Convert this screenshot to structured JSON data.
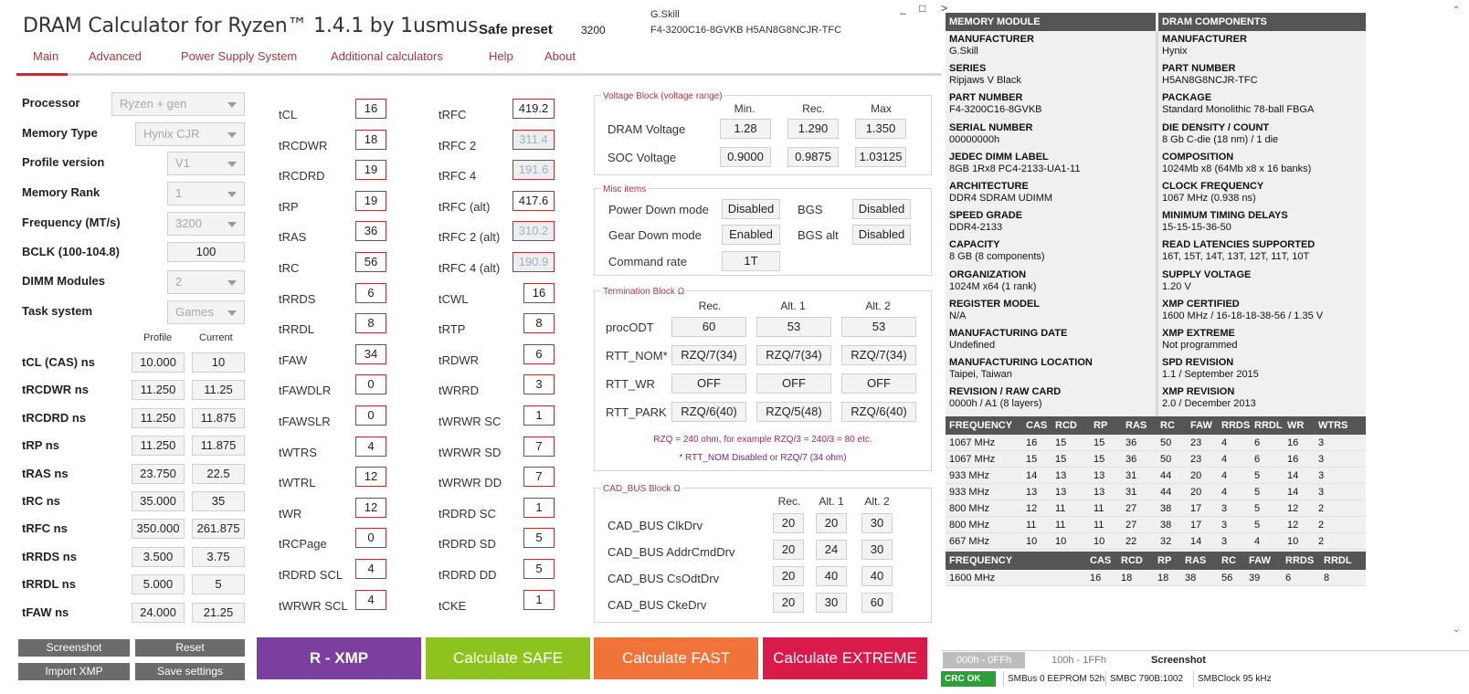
{
  "app": {
    "title": "DRAM Calculator for Ryzen™ 1.4.1 by 1usmus",
    "preset_label": "Safe preset",
    "preset_value": "3200",
    "module_brand": "G.Skill",
    "module_part": "F4-3200C16-8GVKB  H5AN8G8NCJR-TFC",
    "window_min": "_",
    "window_max": "□",
    "window_close": ">"
  },
  "tabs": [
    "Main",
    "Advanced",
    "Power Supply System",
    "Additional calculators",
    "Help",
    "About"
  ],
  "settings": [
    {
      "label": "Processor",
      "value": "Ryzen + gen"
    },
    {
      "label": "Memory Type",
      "value": "Hynix CJR"
    },
    {
      "label": "Profile version",
      "value": "V1"
    },
    {
      "label": "Memory Rank",
      "value": "1"
    },
    {
      "label": "Frequency (MT/s)",
      "value": "3200"
    },
    {
      "label": "BCLK (100-104.8)",
      "value": "100"
    },
    {
      "label": "DIMM Modules",
      "value": "2"
    },
    {
      "label": "Task system",
      "value": "Games"
    }
  ],
  "ns": {
    "col_profile": "Profile",
    "col_current": "Current",
    "rows": [
      {
        "label": "tCL (CAS) ns",
        "profile": "10.000",
        "current": "10"
      },
      {
        "label": "tRCDWR ns",
        "profile": "11.250",
        "current": "11.25"
      },
      {
        "label": "tRCDRD ns",
        "profile": "11.250",
        "current": "11.875"
      },
      {
        "label": "tRP ns",
        "profile": "11.250",
        "current": "11.875"
      },
      {
        "label": "tRAS ns",
        "profile": "23.750",
        "current": "22.5"
      },
      {
        "label": "tRC ns",
        "profile": "35.000",
        "current": "35"
      },
      {
        "label": "tRFC ns",
        "profile": "350.000",
        "current": "261.875"
      },
      {
        "label": "tRRDS ns",
        "profile": "3.500",
        "current": "3.75"
      },
      {
        "label": "tRRDL ns",
        "profile": "5.000",
        "current": "5"
      },
      {
        "label": "tFAW ns",
        "profile": "24.000",
        "current": "21.25"
      }
    ]
  },
  "timings_a": [
    {
      "label": "tCL",
      "value": "16"
    },
    {
      "label": "tRCDWR",
      "value": "18"
    },
    {
      "label": "tRCDRD",
      "value": "19"
    },
    {
      "label": "tRP",
      "value": "19"
    },
    {
      "label": "tRAS",
      "value": "36"
    },
    {
      "label": "tRC",
      "value": "56"
    },
    {
      "label": "tRRDS",
      "value": "6"
    },
    {
      "label": "tRRDL",
      "value": "8"
    },
    {
      "label": "tFAW",
      "value": "34"
    },
    {
      "label": "tFAWDLR",
      "value": "0"
    },
    {
      "label": "tFAWSLR",
      "value": "0"
    },
    {
      "label": "tWTRS",
      "value": "4"
    },
    {
      "label": "tWTRL",
      "value": "12"
    },
    {
      "label": "tWR",
      "value": "12"
    },
    {
      "label": "tRCPage",
      "value": "0"
    },
    {
      "label": "tRDRD SCL",
      "value": "4"
    },
    {
      "label": "tWRWR SCL",
      "value": "4"
    }
  ],
  "timings_b": [
    {
      "label": "tRFC",
      "value": "419.2"
    },
    {
      "label": "tRFC 2",
      "value": "311.4"
    },
    {
      "label": "tRFC 4",
      "value": "191.6"
    },
    {
      "label": "tRFC (alt)",
      "value": "417.6"
    },
    {
      "label": "tRFC 2 (alt)",
      "value": "310.2"
    },
    {
      "label": "tRFC 4 (alt)",
      "value": "190.9"
    },
    {
      "label": "tCWL",
      "value": "16"
    },
    {
      "label": "tRTP",
      "value": "8"
    },
    {
      "label": "tRDWR",
      "value": "6"
    },
    {
      "label": "tWRRD",
      "value": "3"
    },
    {
      "label": "tWRWR SC",
      "value": "1"
    },
    {
      "label": "tWRWR SD",
      "value": "7"
    },
    {
      "label": "tWRWR DD",
      "value": "7"
    },
    {
      "label": "tRDRD SC",
      "value": "1"
    },
    {
      "label": "tRDRD SD",
      "value": "5"
    },
    {
      "label": "tRDRD DD",
      "value": "5"
    },
    {
      "label": "tCKE",
      "value": "1"
    }
  ],
  "voltage": {
    "title": "Voltage Block (voltage range)",
    "h_min": "Min.",
    "h_rec": "Rec.",
    "h_max": "Max",
    "rows": [
      {
        "label": "DRAM Voltage",
        "min": "1.28",
        "rec": "1.290",
        "max": "1.350"
      },
      {
        "label": "SOC Voltage",
        "min": "0.9000",
        "rec": "0.9875",
        "max": "1.03125"
      }
    ]
  },
  "misc": {
    "title": "Misc items",
    "power_down_label": "Power Down mode",
    "power_down": "Disabled",
    "bgs_label": "BGS",
    "bgs": "Disabled",
    "gear_down_label": "Gear Down mode",
    "gear_down": "Enabled",
    "bgs_alt_label": "BGS alt",
    "bgs_alt": "Disabled",
    "cmd_rate_label": "Command rate",
    "cmd_rate": "1T"
  },
  "termination": {
    "title": "Termination Block Ω",
    "h_rec": "Rec.",
    "h_alt1": "Alt. 1",
    "h_alt2": "Alt. 2",
    "rows": [
      {
        "label": "procODT",
        "rec": "60",
        "alt1": "53",
        "alt2": "53"
      },
      {
        "label": "RTT_NOM*",
        "rec": "RZQ/7(34)",
        "alt1": "RZQ/7(34)",
        "alt2": "RZQ/7(34)"
      },
      {
        "label": "RTT_WR",
        "rec": "OFF",
        "alt1": "OFF",
        "alt2": "OFF"
      },
      {
        "label": "RTT_PARK",
        "rec": "RZQ/6(40)",
        "alt1": "RZQ/5(48)",
        "alt2": "RZQ/6(40)"
      }
    ],
    "note1": "RZQ = 240 ohm, for example RZQ/3 = 240/3 = 80 etc.",
    "note2": "* RTT_NOM Disabled or RZQ/7 (34 ohm)",
    "note1_color": "#c2185b",
    "note2_color": "#7b1fa2"
  },
  "cadbus": {
    "title": "CAD_BUS Block Ω",
    "h_rec": "Rec.",
    "h_alt1": "Alt. 1",
    "h_alt2": "Alt. 2",
    "rows": [
      {
        "label": "CAD_BUS ClkDrv",
        "rec": "20",
        "alt1": "20",
        "alt2": "30"
      },
      {
        "label": "CAD_BUS AddrCmdDrv",
        "rec": "20",
        "alt1": "24",
        "alt2": "30"
      },
      {
        "label": "CAD_BUS CsOdtDrv",
        "rec": "20",
        "alt1": "40",
        "alt2": "40"
      },
      {
        "label": "CAD_BUS CkeDrv",
        "rec": "20",
        "alt1": "30",
        "alt2": "60"
      }
    ]
  },
  "buttons": {
    "screenshot": "Screenshot",
    "reset": "Reset",
    "import_xmp": "Import XMP",
    "save_settings": "Save settings",
    "r_xmp": "R - XMP",
    "safe": "Calculate SAFE",
    "fast": "Calculate FAST",
    "extreme": "Calculate EXTREME",
    "color_xmp": "#7b3fa0",
    "color_safe": "#8dc31e",
    "color_fast": "#f0743a",
    "color_extreme": "#d81b4a"
  },
  "spd": {
    "left_header": "MEMORY MODULE",
    "right_header": "DRAM COMPONENTS",
    "left": [
      {
        "k": "MANUFACTURER",
        "v": "G.Skill"
      },
      {
        "k": "SERIES",
        "v": "Ripjaws V Black"
      },
      {
        "k": "PART NUMBER",
        "v": "F4-3200C16-8GVKB"
      },
      {
        "k": "SERIAL NUMBER",
        "v": "00000000h"
      },
      {
        "k": "JEDEC DIMM LABEL",
        "v": "8GB 1Rx8 PC4-2133-UA1-11"
      },
      {
        "k": "ARCHITECTURE",
        "v": "DDR4 SDRAM UDIMM"
      },
      {
        "k": "SPEED GRADE",
        "v": "DDR4-2133"
      },
      {
        "k": "CAPACITY",
        "v": "8 GB (8 components)"
      },
      {
        "k": "ORGANIZATION",
        "v": "1024M x64 (1 rank)"
      },
      {
        "k": "REGISTER MODEL",
        "v": "N/A"
      },
      {
        "k": "MANUFACTURING DATE",
        "v": "Undefined"
      },
      {
        "k": "MANUFACTURING LOCATION",
        "v": "Taipei, Taiwan"
      },
      {
        "k": "REVISION / RAW CARD",
        "v": "0000h / A1 (8 layers)"
      }
    ],
    "right": [
      {
        "k": "MANUFACTURER",
        "v": "Hynix"
      },
      {
        "k": "PART NUMBER",
        "v": "H5AN8G8NCJR-TFC"
      },
      {
        "k": "PACKAGE",
        "v": "Standard Monolithic 78-ball FBGA"
      },
      {
        "k": "DIE DENSITY / COUNT",
        "v": "8 Gb C-die (18 nm) / 1 die"
      },
      {
        "k": "COMPOSITION",
        "v": "1024Mb x8 (64Mb x8 x 16 banks)"
      },
      {
        "k": "CLOCK FREQUENCY",
        "v": "1067 MHz (0.938 ns)"
      },
      {
        "k": "MINIMUM TIMING DELAYS",
        "v": "15-15-15-36-50"
      },
      {
        "k": "READ LATENCIES SUPPORTED",
        "v": "16T, 15T, 14T, 13T, 12T, 11T, 10T"
      },
      {
        "k": "SUPPLY VOLTAGE",
        "v": "1.20 V"
      },
      {
        "k": "XMP CERTIFIED",
        "v": "1600 MHz / 16-18-18-38-56 / 1.35 V"
      },
      {
        "k": "XMP EXTREME",
        "v": "Not programmed"
      },
      {
        "k": "SPD REVISION",
        "v": "1.1 / September 2015"
      },
      {
        "k": "XMP REVISION",
        "v": "2.0 / December 2013"
      }
    ],
    "table1": {
      "headers": [
        "FREQUENCY",
        "CAS",
        "RCD",
        "RP",
        "RAS",
        "RC",
        "FAW",
        "RRDS",
        "RRDL",
        "WR",
        "WTRS"
      ],
      "rows": [
        [
          "1067 MHz",
          "16",
          "15",
          "15",
          "36",
          "50",
          "23",
          "4",
          "6",
          "16",
          "3"
        ],
        [
          "1067 MHz",
          "15",
          "15",
          "15",
          "36",
          "50",
          "23",
          "4",
          "6",
          "16",
          "3"
        ],
        [
          "933 MHz",
          "14",
          "13",
          "13",
          "31",
          "44",
          "20",
          "4",
          "5",
          "14",
          "3"
        ],
        [
          "933 MHz",
          "13",
          "13",
          "13",
          "31",
          "44",
          "20",
          "4",
          "5",
          "14",
          "3"
        ],
        [
          "800 MHz",
          "12",
          "11",
          "11",
          "27",
          "38",
          "17",
          "3",
          "5",
          "12",
          "2"
        ],
        [
          "800 MHz",
          "11",
          "11",
          "11",
          "27",
          "38",
          "17",
          "3",
          "5",
          "12",
          "2"
        ],
        [
          "667 MHz",
          "10",
          "10",
          "10",
          "22",
          "32",
          "14",
          "3",
          "4",
          "10",
          "2"
        ]
      ]
    },
    "table2": {
      "headers": [
        "FREQUENCY",
        "CAS",
        "RCD",
        "RP",
        "RAS",
        "RC",
        "FAW",
        "RRDS",
        "RRDL"
      ],
      "rows": [
        [
          "1600 MHz",
          "16",
          "18",
          "18",
          "38",
          "56",
          "39",
          "6",
          "8"
        ]
      ]
    }
  },
  "bottom": {
    "tab1": "000h - 0FFh",
    "tab2": "100h - 1FFh",
    "tab3": "Screenshot",
    "crc": "CRC OK",
    "smbus": "SMBus 0 EEPROM 52h",
    "smbc": "SMBC 790B:1002",
    "smbclock": "SMBClock 95 kHz",
    "crc_color": "#2e9e3a"
  }
}
